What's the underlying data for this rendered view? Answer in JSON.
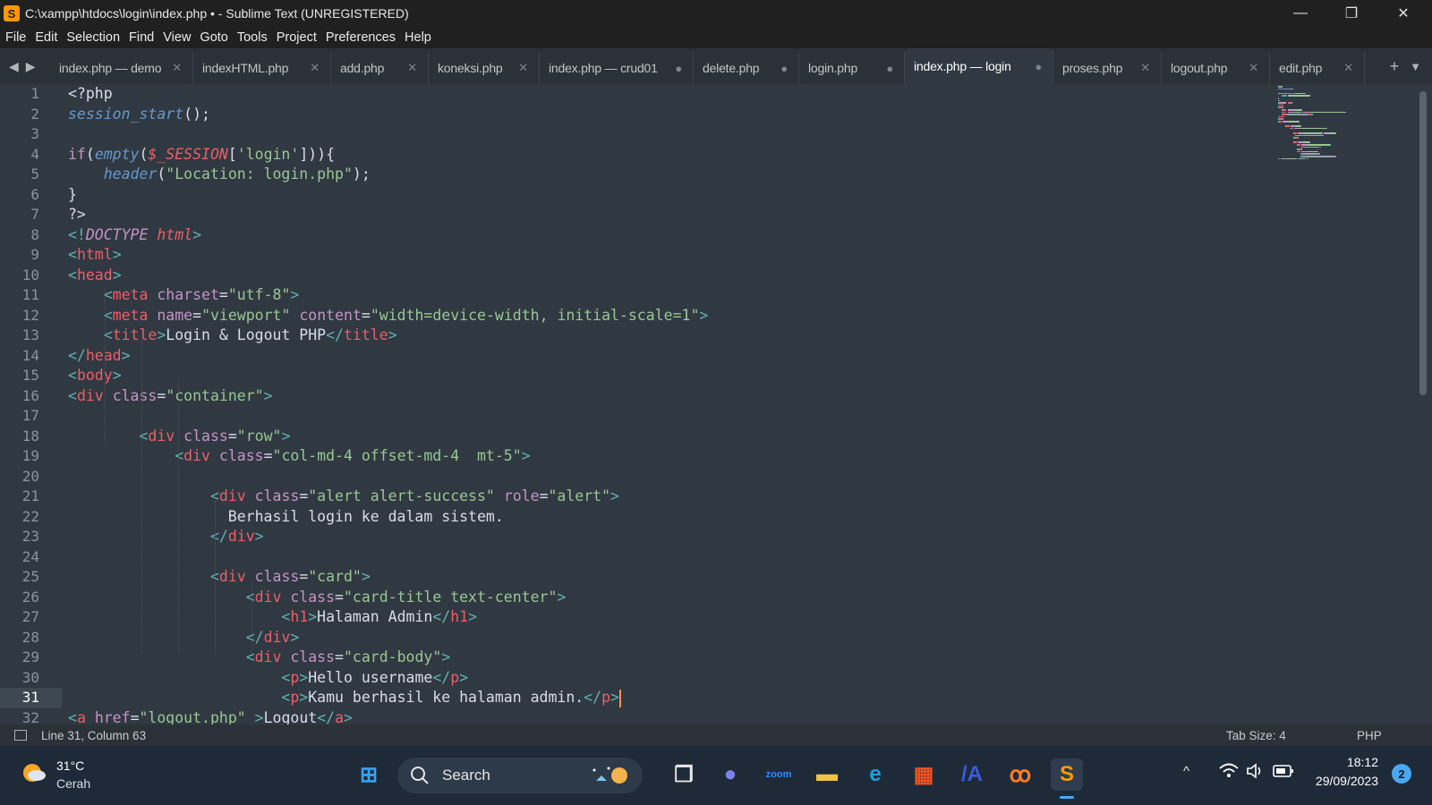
{
  "window": {
    "title": "C:\\xampp\\htdocs\\login\\index.php • - Sublime Text (UNREGISTERED)",
    "app_icon": "S",
    "controls": {
      "minimize": "—",
      "restore": "❐",
      "close": "✕"
    }
  },
  "menu": [
    "File",
    "Edit",
    "Selection",
    "Find",
    "View",
    "Goto",
    "Tools",
    "Project",
    "Preferences",
    "Help"
  ],
  "tabs": [
    {
      "label": "index.php — demo",
      "state": "close",
      "active": false
    },
    {
      "label": "indexHTML.php",
      "state": "close",
      "active": false
    },
    {
      "label": "add.php",
      "state": "close",
      "active": false
    },
    {
      "label": "koneksi.php",
      "state": "close",
      "active": false
    },
    {
      "label": "index.php — crud01",
      "state": "dirty",
      "active": false
    },
    {
      "label": "delete.php",
      "state": "dirty",
      "active": false
    },
    {
      "label": "login.php",
      "state": "dirty",
      "active": false
    },
    {
      "label": "index.php — login",
      "state": "dirty",
      "active": true
    },
    {
      "label": "proses.php",
      "state": "close",
      "active": false
    },
    {
      "label": "logout.php",
      "state": "close",
      "active": false
    },
    {
      "label": "edit.php",
      "state": "close",
      "active": false
    }
  ],
  "tab_icons": {
    "close": "✕",
    "dirty": "●",
    "prev": "◀",
    "next": "▶",
    "new": "+",
    "menu": "▼"
  },
  "editor": {
    "current_line": 31,
    "lines": [
      [
        [
          "t-text",
          "<?php"
        ]
      ],
      [
        [
          "t-fn",
          "session_start"
        ],
        [
          "t-text",
          "();"
        ]
      ],
      [],
      [
        [
          "t-kw",
          "if"
        ],
        [
          "t-text",
          "("
        ],
        [
          "t-fn",
          "empty"
        ],
        [
          "t-text",
          "("
        ],
        [
          "t-var",
          "$_SESSION"
        ],
        [
          "t-text",
          "["
        ],
        [
          "t-str",
          "'login'"
        ],
        [
          "t-text",
          "])){"
        ]
      ],
      [
        [
          "t-text",
          "    "
        ],
        [
          "t-fn",
          "header"
        ],
        [
          "t-text",
          "("
        ],
        [
          "t-str",
          "\"Location: login.php\""
        ],
        [
          "t-text",
          ");"
        ]
      ],
      [
        [
          "t-text",
          "}"
        ]
      ],
      [
        [
          "t-text",
          "?>"
        ]
      ],
      [
        [
          "t-punc",
          "<!"
        ],
        [
          "t-doctype",
          "DOCTYPE"
        ],
        [
          "t-text",
          " "
        ],
        [
          "t-var",
          "html"
        ],
        [
          "t-punc",
          ">"
        ]
      ],
      [
        [
          "t-punc",
          "<"
        ],
        [
          "t-tag",
          "html"
        ],
        [
          "t-punc",
          ">"
        ]
      ],
      [
        [
          "t-punc",
          "<"
        ],
        [
          "t-tag",
          "head"
        ],
        [
          "t-punc",
          ">"
        ]
      ],
      [
        [
          "t-text",
          "    "
        ],
        [
          "t-punc",
          "<"
        ],
        [
          "t-tag",
          "meta"
        ],
        [
          "t-text",
          " "
        ],
        [
          "t-attr",
          "charset"
        ],
        [
          "t-text",
          "="
        ],
        [
          "t-str",
          "\"utf-8\""
        ],
        [
          "t-punc",
          ">"
        ]
      ],
      [
        [
          "t-text",
          "    "
        ],
        [
          "t-punc",
          "<"
        ],
        [
          "t-tag",
          "meta"
        ],
        [
          "t-text",
          " "
        ],
        [
          "t-attr",
          "name"
        ],
        [
          "t-text",
          "="
        ],
        [
          "t-str",
          "\"viewport\""
        ],
        [
          "t-text",
          " "
        ],
        [
          "t-attr",
          "content"
        ],
        [
          "t-text",
          "="
        ],
        [
          "t-str",
          "\"width=device-width, initial-scale=1\""
        ],
        [
          "t-punc",
          ">"
        ]
      ],
      [
        [
          "t-text",
          "    "
        ],
        [
          "t-punc",
          "<"
        ],
        [
          "t-tag",
          "title"
        ],
        [
          "t-punc",
          ">"
        ],
        [
          "t-text",
          "Login & Logout PHP"
        ],
        [
          "t-punc",
          "</"
        ],
        [
          "t-tag",
          "title"
        ],
        [
          "t-punc",
          ">"
        ]
      ],
      [
        [
          "t-punc",
          "</"
        ],
        [
          "t-tag",
          "head"
        ],
        [
          "t-punc",
          ">"
        ]
      ],
      [
        [
          "t-punc",
          "<"
        ],
        [
          "t-tag",
          "body"
        ],
        [
          "t-punc",
          ">"
        ]
      ],
      [
        [
          "t-punc",
          "<"
        ],
        [
          "t-tag",
          "div"
        ],
        [
          "t-text",
          " "
        ],
        [
          "t-attr",
          "class"
        ],
        [
          "t-text",
          "="
        ],
        [
          "t-str",
          "\"container\""
        ],
        [
          "t-punc",
          ">"
        ]
      ],
      [],
      [
        [
          "t-text",
          "        "
        ],
        [
          "t-punc",
          "<"
        ],
        [
          "t-tag",
          "div"
        ],
        [
          "t-text",
          " "
        ],
        [
          "t-attr",
          "class"
        ],
        [
          "t-text",
          "="
        ],
        [
          "t-str",
          "\"row\""
        ],
        [
          "t-punc",
          ">"
        ]
      ],
      [
        [
          "t-text",
          "            "
        ],
        [
          "t-punc",
          "<"
        ],
        [
          "t-tag",
          "div"
        ],
        [
          "t-text",
          " "
        ],
        [
          "t-attr",
          "class"
        ],
        [
          "t-text",
          "="
        ],
        [
          "t-str",
          "\"col-md-4 offset-md-4  mt-5\""
        ],
        [
          "t-punc",
          ">"
        ]
      ],
      [],
      [
        [
          "t-text",
          "                "
        ],
        [
          "t-punc",
          "<"
        ],
        [
          "t-tag",
          "div"
        ],
        [
          "t-text",
          " "
        ],
        [
          "t-attr",
          "class"
        ],
        [
          "t-text",
          "="
        ],
        [
          "t-str",
          "\"alert alert-success\""
        ],
        [
          "t-text",
          " "
        ],
        [
          "t-attr",
          "role"
        ],
        [
          "t-text",
          "="
        ],
        [
          "t-str",
          "\"alert\""
        ],
        [
          "t-punc",
          ">"
        ]
      ],
      [
        [
          "t-text",
          "                  Berhasil login ke dalam sistem."
        ]
      ],
      [
        [
          "t-text",
          "                "
        ],
        [
          "t-punc",
          "</"
        ],
        [
          "t-tag",
          "div"
        ],
        [
          "t-punc",
          ">"
        ]
      ],
      [],
      [
        [
          "t-text",
          "                "
        ],
        [
          "t-punc",
          "<"
        ],
        [
          "t-tag",
          "div"
        ],
        [
          "t-text",
          " "
        ],
        [
          "t-attr",
          "class"
        ],
        [
          "t-text",
          "="
        ],
        [
          "t-str",
          "\"card\""
        ],
        [
          "t-punc",
          ">"
        ]
      ],
      [
        [
          "t-text",
          "                    "
        ],
        [
          "t-punc",
          "<"
        ],
        [
          "t-tag",
          "div"
        ],
        [
          "t-text",
          " "
        ],
        [
          "t-attr",
          "class"
        ],
        [
          "t-text",
          "="
        ],
        [
          "t-str",
          "\"card-title text-center\""
        ],
        [
          "t-punc",
          ">"
        ]
      ],
      [
        [
          "t-text",
          "                        "
        ],
        [
          "t-punc",
          "<"
        ],
        [
          "t-tag",
          "h1"
        ],
        [
          "t-punc",
          ">"
        ],
        [
          "t-text",
          "Halaman Admin"
        ],
        [
          "t-punc",
          "</"
        ],
        [
          "t-tag",
          "h1"
        ],
        [
          "t-punc",
          ">"
        ]
      ],
      [
        [
          "t-text",
          "                    "
        ],
        [
          "t-punc",
          "</"
        ],
        [
          "t-tag",
          "div"
        ],
        [
          "t-punc",
          ">"
        ]
      ],
      [
        [
          "t-text",
          "                    "
        ],
        [
          "t-punc",
          "<"
        ],
        [
          "t-tag",
          "div"
        ],
        [
          "t-text",
          " "
        ],
        [
          "t-attr",
          "class"
        ],
        [
          "t-text",
          "="
        ],
        [
          "t-str",
          "\"card-body\""
        ],
        [
          "t-punc",
          ">"
        ]
      ],
      [
        [
          "t-text",
          "                        "
        ],
        [
          "t-punc",
          "<"
        ],
        [
          "t-tag",
          "p"
        ],
        [
          "t-punc",
          ">"
        ],
        [
          "t-text",
          "Hello username"
        ],
        [
          "t-punc",
          "</"
        ],
        [
          "t-tag",
          "p"
        ],
        [
          "t-punc",
          ">"
        ]
      ],
      [
        [
          "t-text",
          "                        "
        ],
        [
          "t-punc",
          "<"
        ],
        [
          "t-tag",
          "p"
        ],
        [
          "t-punc",
          ">"
        ],
        [
          "t-text",
          "Kamu berhasil ke halaman admin."
        ],
        [
          "t-punc",
          "</"
        ],
        [
          "t-tag",
          "p"
        ],
        [
          "t-punc",
          ">"
        ]
      ],
      [
        [
          "t-punc",
          "<"
        ],
        [
          "t-tag",
          "a"
        ],
        [
          "t-text",
          " "
        ],
        [
          "t-attr",
          "href"
        ],
        [
          "t-text",
          "="
        ],
        [
          "t-str",
          "\"logout.php\""
        ],
        [
          "t-text",
          " "
        ],
        [
          "t-punc",
          ">"
        ],
        [
          "t-text",
          "Logout"
        ],
        [
          "t-punc",
          "</"
        ],
        [
          "t-tag",
          "a"
        ],
        [
          "t-punc",
          ">"
        ]
      ]
    ]
  },
  "status": {
    "position": "Line 31, Column 63",
    "tab_size": "Tab Size: 4",
    "syntax": "PHP"
  },
  "taskbar": {
    "weather_temp": "31°C",
    "weather_desc": "Cerah",
    "search_label": "Search",
    "time": "18:12",
    "date": "29/09/2023",
    "notification_count": "2",
    "tray_chevron": "^",
    "apps": [
      {
        "name": "start-icon",
        "glyph": "⊞",
        "color": "#3aa0f0"
      },
      {
        "name": "task-view-icon",
        "glyph": "❐",
        "color": "#e8e8e8"
      },
      {
        "name": "chat-icon",
        "glyph": "●",
        "color": "#7b83eb"
      },
      {
        "name": "zoom-icon",
        "glyph": "zoom",
        "color": "#2d8cff"
      },
      {
        "name": "file-explorer-icon",
        "glyph": "▬",
        "color": "#f5c242"
      },
      {
        "name": "edge-icon",
        "glyph": "e",
        "color": "#1fa0e0"
      },
      {
        "name": "store-icon",
        "glyph": "▦",
        "color": "#f25022"
      },
      {
        "name": "visual-studio-code-icon",
        "glyph": "/A",
        "color": "#3b5bdb"
      },
      {
        "name": "xampp-icon",
        "glyph": "ꝏ",
        "color": "#fb7a24"
      },
      {
        "name": "sublime-text-icon",
        "glyph": "S",
        "color": "#ff9800"
      }
    ]
  }
}
